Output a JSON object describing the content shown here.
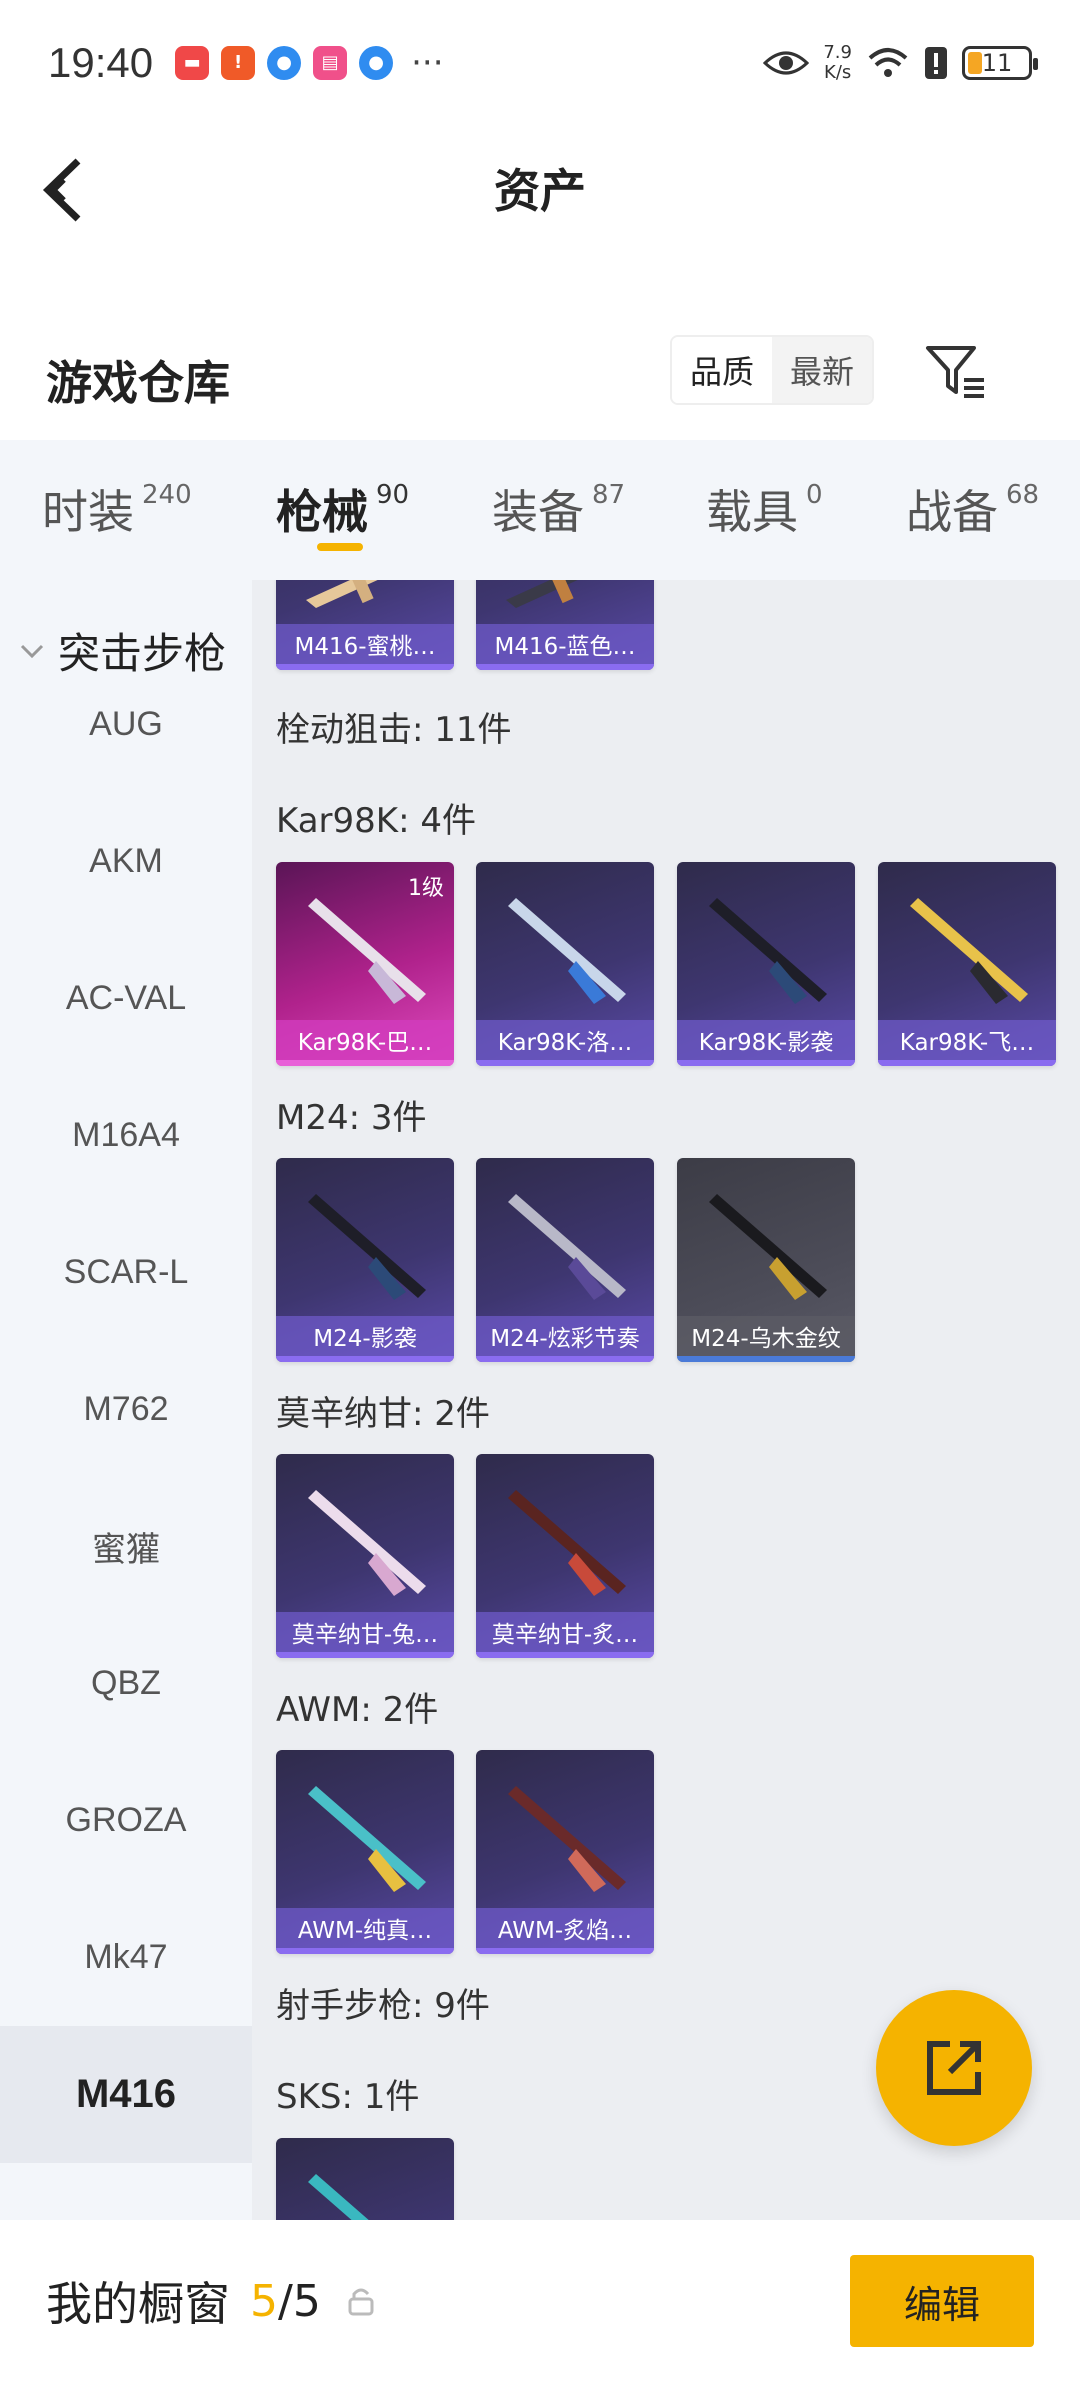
{
  "status_bar": {
    "time": "19:40",
    "net_speed_value": "7.9",
    "net_speed_unit": "K/s",
    "battery": "11",
    "more": "···",
    "icons": [
      "app-red-icon",
      "app-orange-icon",
      "app-blue-icon",
      "app-pink-icon",
      "app-blue-icon",
      "eye-icon",
      "wifi-icon",
      "alert-icon",
      "battery-icon"
    ]
  },
  "header": {
    "title": "资产"
  },
  "warehouse": {
    "title": "游戏仓库",
    "sort_options": [
      "品质",
      "最新"
    ],
    "sort_selected": "品质"
  },
  "tabs": [
    {
      "label": "时装",
      "count": "240"
    },
    {
      "label": "枪械",
      "count": "90",
      "active": true
    },
    {
      "label": "装备",
      "count": "87"
    },
    {
      "label": "载具",
      "count": "0"
    },
    {
      "label": "战备",
      "count": "68"
    }
  ],
  "sidebar": {
    "group": "突击步枪",
    "items": [
      "AUG",
      "AKM",
      "AC-VAL",
      "M16A4",
      "SCAR-L",
      "M762",
      "蜜獾",
      "QBZ",
      "GROZA",
      "Mk47",
      "M416"
    ],
    "active": "M416"
  },
  "content": {
    "top_cards": [
      "M416-蜜桃…",
      "M416-蓝色…"
    ],
    "category_bolt": "栓动狙击: 11件",
    "groups": [
      {
        "title": "Kar98K: 4件",
        "items": [
          {
            "name": "Kar98K-巴…",
            "level": "1级",
            "rarity": "pink"
          },
          {
            "name": "Kar98K-洛…",
            "rarity": "purple"
          },
          {
            "name": "Kar98K-影袭",
            "rarity": "purple"
          },
          {
            "name": "Kar98K-飞…",
            "rarity": "purple"
          }
        ]
      },
      {
        "title": "M24: 3件",
        "items": [
          {
            "name": "M24-影袭",
            "rarity": "purple"
          },
          {
            "name": "M24-炫彩节奏",
            "rarity": "purple"
          },
          {
            "name": "M24-乌木金纹",
            "rarity": "gray"
          }
        ]
      },
      {
        "title": "莫辛纳甘: 2件",
        "items": [
          {
            "name": "莫辛纳甘-兔…",
            "rarity": "purple"
          },
          {
            "name": "莫辛纳甘-炙…",
            "rarity": "purple"
          }
        ]
      },
      {
        "title": "AWM: 2件",
        "items": [
          {
            "name": "AWM-纯真…",
            "rarity": "purple"
          },
          {
            "name": "AWM-炙焰…",
            "rarity": "purple"
          }
        ]
      }
    ],
    "category_dmr": "射手步枪: 9件",
    "sks_title": "SKS: 1件"
  },
  "bottom_bar": {
    "label": "我的橱窗",
    "current": "5",
    "total": "/5",
    "edit": "编辑"
  },
  "colors": {
    "accent": "#f5b300",
    "card_purple": "#3e3670",
    "card_pink": "#b0228c",
    "card_gray": "#4c4c58"
  }
}
